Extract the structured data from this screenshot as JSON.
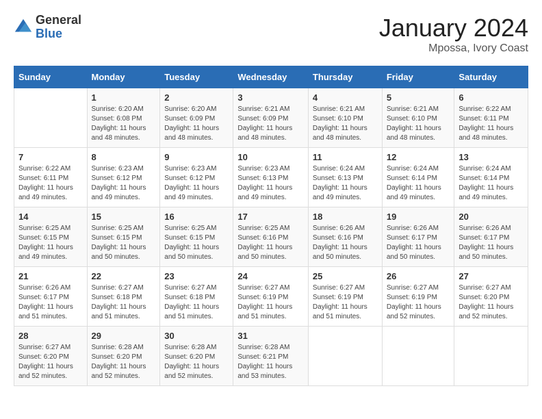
{
  "header": {
    "logo_general": "General",
    "logo_blue": "Blue",
    "month": "January 2024",
    "location": "Mpossa, Ivory Coast"
  },
  "days_of_week": [
    "Sunday",
    "Monday",
    "Tuesday",
    "Wednesday",
    "Thursday",
    "Friday",
    "Saturday"
  ],
  "weeks": [
    [
      {
        "day": "",
        "info": ""
      },
      {
        "day": "1",
        "info": "Sunrise: 6:20 AM\nSunset: 6:08 PM\nDaylight: 11 hours and 48 minutes."
      },
      {
        "day": "2",
        "info": "Sunrise: 6:20 AM\nSunset: 6:09 PM\nDaylight: 11 hours and 48 minutes."
      },
      {
        "day": "3",
        "info": "Sunrise: 6:21 AM\nSunset: 6:09 PM\nDaylight: 11 hours and 48 minutes."
      },
      {
        "day": "4",
        "info": "Sunrise: 6:21 AM\nSunset: 6:10 PM\nDaylight: 11 hours and 48 minutes."
      },
      {
        "day": "5",
        "info": "Sunrise: 6:21 AM\nSunset: 6:10 PM\nDaylight: 11 hours and 48 minutes."
      },
      {
        "day": "6",
        "info": "Sunrise: 6:22 AM\nSunset: 6:11 PM\nDaylight: 11 hours and 48 minutes."
      }
    ],
    [
      {
        "day": "7",
        "info": "Sunrise: 6:22 AM\nSunset: 6:11 PM\nDaylight: 11 hours and 49 minutes."
      },
      {
        "day": "8",
        "info": "Sunrise: 6:23 AM\nSunset: 6:12 PM\nDaylight: 11 hours and 49 minutes."
      },
      {
        "day": "9",
        "info": "Sunrise: 6:23 AM\nSunset: 6:12 PM\nDaylight: 11 hours and 49 minutes."
      },
      {
        "day": "10",
        "info": "Sunrise: 6:23 AM\nSunset: 6:13 PM\nDaylight: 11 hours and 49 minutes."
      },
      {
        "day": "11",
        "info": "Sunrise: 6:24 AM\nSunset: 6:13 PM\nDaylight: 11 hours and 49 minutes."
      },
      {
        "day": "12",
        "info": "Sunrise: 6:24 AM\nSunset: 6:14 PM\nDaylight: 11 hours and 49 minutes."
      },
      {
        "day": "13",
        "info": "Sunrise: 6:24 AM\nSunset: 6:14 PM\nDaylight: 11 hours and 49 minutes."
      }
    ],
    [
      {
        "day": "14",
        "info": "Sunrise: 6:25 AM\nSunset: 6:15 PM\nDaylight: 11 hours and 49 minutes."
      },
      {
        "day": "15",
        "info": "Sunrise: 6:25 AM\nSunset: 6:15 PM\nDaylight: 11 hours and 50 minutes."
      },
      {
        "day": "16",
        "info": "Sunrise: 6:25 AM\nSunset: 6:15 PM\nDaylight: 11 hours and 50 minutes."
      },
      {
        "day": "17",
        "info": "Sunrise: 6:25 AM\nSunset: 6:16 PM\nDaylight: 11 hours and 50 minutes."
      },
      {
        "day": "18",
        "info": "Sunrise: 6:26 AM\nSunset: 6:16 PM\nDaylight: 11 hours and 50 minutes."
      },
      {
        "day": "19",
        "info": "Sunrise: 6:26 AM\nSunset: 6:17 PM\nDaylight: 11 hours and 50 minutes."
      },
      {
        "day": "20",
        "info": "Sunrise: 6:26 AM\nSunset: 6:17 PM\nDaylight: 11 hours and 50 minutes."
      }
    ],
    [
      {
        "day": "21",
        "info": "Sunrise: 6:26 AM\nSunset: 6:17 PM\nDaylight: 11 hours and 51 minutes."
      },
      {
        "day": "22",
        "info": "Sunrise: 6:27 AM\nSunset: 6:18 PM\nDaylight: 11 hours and 51 minutes."
      },
      {
        "day": "23",
        "info": "Sunrise: 6:27 AM\nSunset: 6:18 PM\nDaylight: 11 hours and 51 minutes."
      },
      {
        "day": "24",
        "info": "Sunrise: 6:27 AM\nSunset: 6:19 PM\nDaylight: 11 hours and 51 minutes."
      },
      {
        "day": "25",
        "info": "Sunrise: 6:27 AM\nSunset: 6:19 PM\nDaylight: 11 hours and 51 minutes."
      },
      {
        "day": "26",
        "info": "Sunrise: 6:27 AM\nSunset: 6:19 PM\nDaylight: 11 hours and 52 minutes."
      },
      {
        "day": "27",
        "info": "Sunrise: 6:27 AM\nSunset: 6:20 PM\nDaylight: 11 hours and 52 minutes."
      }
    ],
    [
      {
        "day": "28",
        "info": "Sunrise: 6:27 AM\nSunset: 6:20 PM\nDaylight: 11 hours and 52 minutes."
      },
      {
        "day": "29",
        "info": "Sunrise: 6:28 AM\nSunset: 6:20 PM\nDaylight: 11 hours and 52 minutes."
      },
      {
        "day": "30",
        "info": "Sunrise: 6:28 AM\nSunset: 6:20 PM\nDaylight: 11 hours and 52 minutes."
      },
      {
        "day": "31",
        "info": "Sunrise: 6:28 AM\nSunset: 6:21 PM\nDaylight: 11 hours and 53 minutes."
      },
      {
        "day": "",
        "info": ""
      },
      {
        "day": "",
        "info": ""
      },
      {
        "day": "",
        "info": ""
      }
    ]
  ]
}
